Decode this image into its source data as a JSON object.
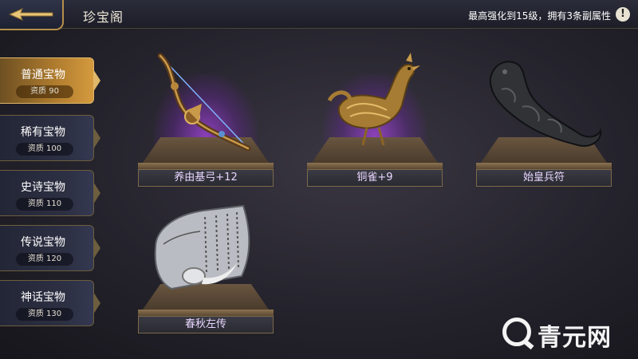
{
  "header": {
    "title": "珍宝阁",
    "tip": "最高强化到15级，拥有3条副属性",
    "info_icon": "!"
  },
  "sidebar": {
    "tabs": [
      {
        "label": "普通宝物",
        "badge": "资质 90",
        "active": true
      },
      {
        "label": "稀有宝物",
        "badge": "资质 100",
        "active": false
      },
      {
        "label": "史诗宝物",
        "badge": "资质 110",
        "active": false
      },
      {
        "label": "传说宝物",
        "badge": "资质 120",
        "active": false
      },
      {
        "label": "神话宝物",
        "badge": "资质 130",
        "active": false
      }
    ]
  },
  "items": [
    {
      "name": "养由基弓+12",
      "icon": "bow-icon"
    },
    {
      "name": "铜雀+9",
      "icon": "bronze-bird-icon"
    },
    {
      "name": "始皇兵符",
      "icon": "tiger-tally-icon"
    },
    {
      "name": "春秋左传",
      "icon": "scroll-book-icon"
    }
  ],
  "watermark": {
    "text": "青元网"
  },
  "colors": {
    "accent_gold": "#d49a3e",
    "glow_purple": "#aa46e6",
    "item_name": "#e9d7ff"
  }
}
